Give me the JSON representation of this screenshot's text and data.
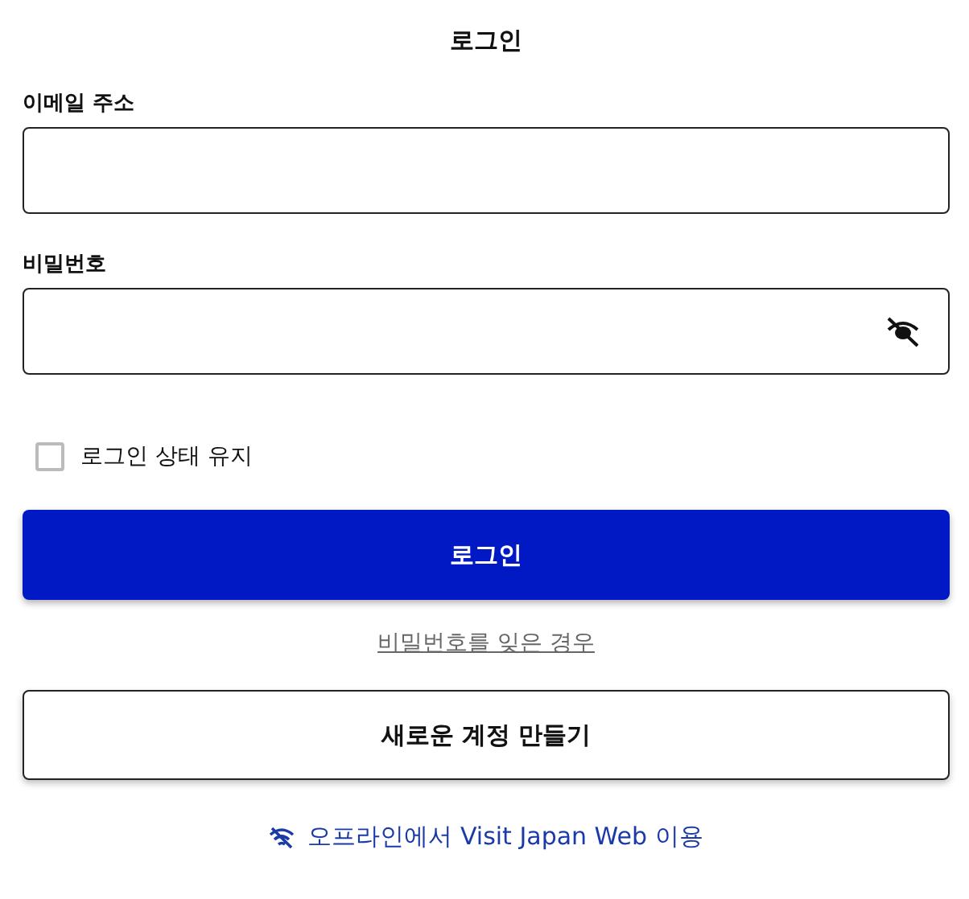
{
  "title": "로그인",
  "fields": [
    {
      "label": "이메일 주소",
      "kind": "text"
    },
    {
      "label": "비밀번호",
      "kind": "password"
    }
  ],
  "remember": {
    "label": "로그인 상태 유지",
    "checked": false
  },
  "login_button": "로그인",
  "forgot_link": "비밀번호를 잊은 경우",
  "create_button": "새로운 계정 만들기",
  "offline_link": "오프라인에서 Visit Japan Web 이용"
}
